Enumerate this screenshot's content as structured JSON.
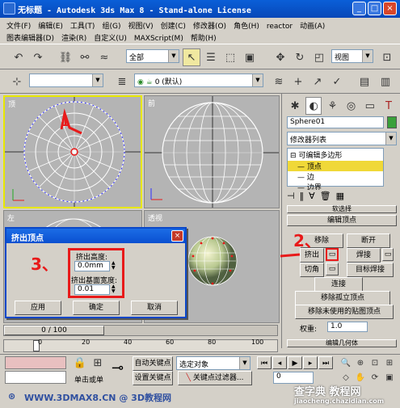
{
  "window": {
    "title": "无标题  - Autodesk 3ds Max 8  - Stand-alone License",
    "minimize": "_",
    "maximize": "□",
    "close": "×"
  },
  "menu": {
    "row1": [
      "文件(F)",
      "编辑(E)",
      "工具(T)",
      "组(G)",
      "视图(V)",
      "创建(C)",
      "修改器(O)",
      "角色(H)",
      "reactor",
      "动画(A)"
    ],
    "row2": [
      "图表编辑器(D)",
      "渲染(R)",
      "自定义(U)",
      "MAXScript(M)",
      "帮助(H)"
    ]
  },
  "toolbar": {
    "selection_filter": "全部",
    "coord_system": "视图",
    "layer_name": "0 (默认)"
  },
  "viewports": {
    "top": "顶",
    "front": "前",
    "left": "左",
    "perspective": "透视"
  },
  "command_panel": {
    "object_name": "Sphere01",
    "modifier_list": "修改器列表",
    "stack_root": "可编辑多边形",
    "stack_items": [
      "顶点",
      "边",
      "边界"
    ],
    "rollout_title": "编辑顶点",
    "buttons": {
      "remove": "移除",
      "break": "断开",
      "extrude": "挤出",
      "weld": "焊接",
      "chamfer": "切角",
      "target_weld": "目标焊接",
      "connect": "连接",
      "remove_isolated": "移除孤立顶点",
      "remove_unused_map": "移除未使用的贴图顶点"
    },
    "weight_label": "权重:",
    "weight_value": "1.0",
    "next_rollout": "编辑几何体",
    "prev_rollout": "软选择"
  },
  "dialog": {
    "title": "挤出顶点",
    "close": "×",
    "height_label": "挤出高度:",
    "height_value": "0.0mm",
    "width_label": "挤出基面宽度:",
    "width_value": "0.01",
    "apply": "应用",
    "ok": "确定",
    "cancel": "取消"
  },
  "annotations": {
    "step1": "1",
    "step2": "2、",
    "step3": "3、"
  },
  "timeline": {
    "frame": "0 / 100",
    "ticks": [
      "0",
      "20",
      "40",
      "60",
      "80",
      "100"
    ]
  },
  "status": {
    "auto_key": "自动关键点",
    "set_key": "设置关键点",
    "selected_obj": "选定对象",
    "key_filters": "关键点过滤器...",
    "click_hint": "单击或单",
    "frame_value": "0"
  },
  "watermark": {
    "left": "WWW.3DMAX8.CN @ 3D教程网",
    "right_top": "查字典 教程网",
    "right_bottom": "jiaocheng.chazidian.com"
  },
  "colors": {
    "title_blue": "#0a5fd8",
    "active_border": "#e8e800",
    "annotation_red": "#e81a1a",
    "sphere_wire": "#ffffff",
    "wire_blue": "#3030ff"
  }
}
